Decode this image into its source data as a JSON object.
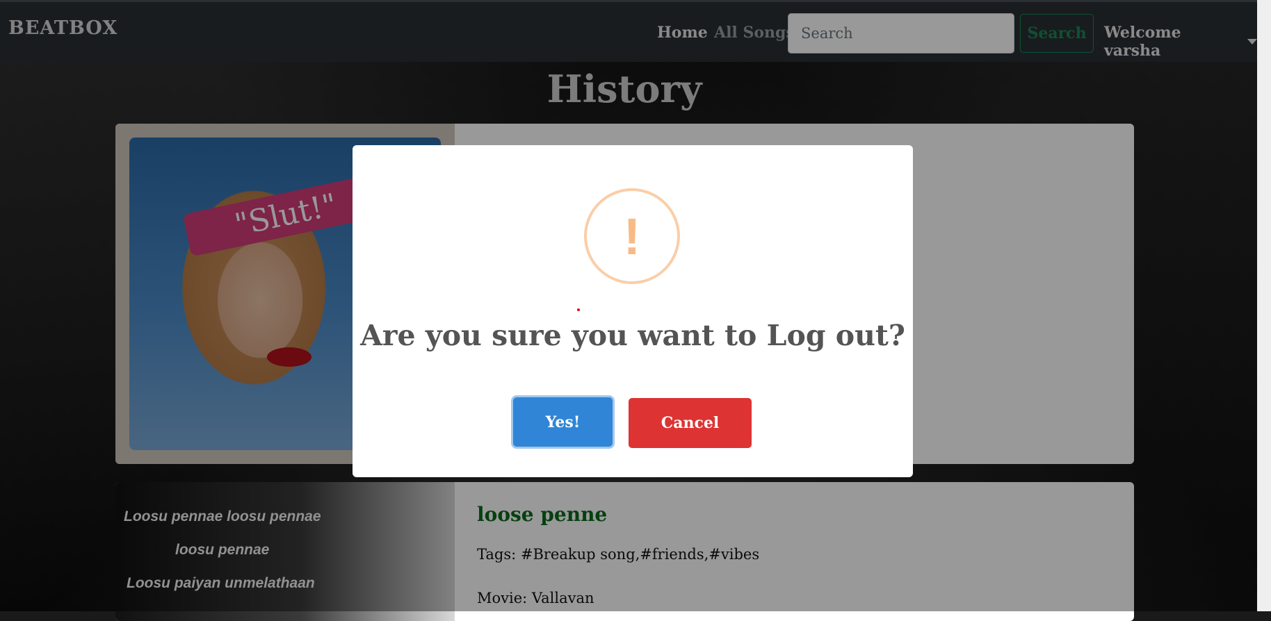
{
  "navbar": {
    "brand": "BEATBOX",
    "links": {
      "home": "Home",
      "all_songs": "All Songs"
    },
    "search": {
      "placeholder": "Search",
      "button_label": "Search"
    },
    "user_menu": "Welcome varsha"
  },
  "page": {
    "title": "History"
  },
  "songs": [
    {
      "art_text": "\"Slut!\""
    },
    {
      "title": "loose penne",
      "tags": "Tags: #Breakup song,#friends,#vibes",
      "movie": "Movie: Vallavan",
      "lyrics": [
        "Loosu pennae loosu pennae",
        "loosu pennae",
        "Loosu paiyan unmelathaan"
      ]
    }
  ],
  "modal": {
    "icon": "exclamation-icon",
    "icon_glyph": "!",
    "title": "Are you sure you want to Log out?",
    "confirm_label": "Yes!",
    "cancel_label": "Cancel"
  },
  "colors": {
    "navbar_bg": "#2b3035",
    "search_button": "#198754",
    "song_title": "#0b6b1c",
    "warning_icon": "#f8bb86",
    "confirm_button": "#3085d6",
    "cancel_button": "#dd3333"
  }
}
